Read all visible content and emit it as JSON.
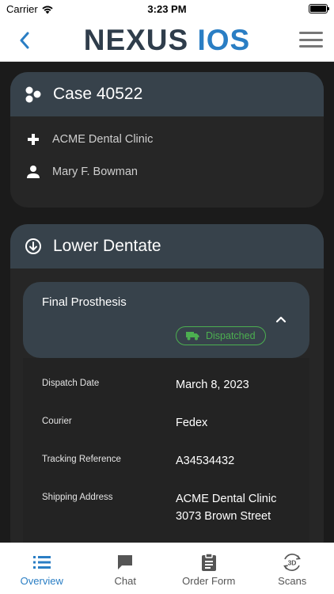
{
  "status_bar": {
    "carrier": "Carrier",
    "time": "3:23 PM"
  },
  "nav": {
    "logo_primary": "NEXUS",
    "logo_secondary": "IOS"
  },
  "case_card": {
    "title": "Case 40522",
    "clinic": "ACME Dental Clinic",
    "patient": "Mary F. Bowman"
  },
  "dentate_card": {
    "title": "Lower Dentate",
    "prosthesis": {
      "title": "Final Prosthesis",
      "status": "Dispatched"
    },
    "details": [
      {
        "label": "Dispatch Date",
        "value": "March 8, 2023"
      },
      {
        "label": "Courier",
        "value": "Fedex"
      },
      {
        "label": "Tracking Reference",
        "value": "A34534432"
      },
      {
        "label": "Shipping Address",
        "value": "ACME Dental Clinic",
        "value2": "3073 Brown Street"
      }
    ]
  },
  "tabs": [
    {
      "label": "Overview",
      "icon": "list-icon",
      "active": true
    },
    {
      "label": "Chat",
      "icon": "chat-icon",
      "active": false
    },
    {
      "label": "Order Form",
      "icon": "clipboard-icon",
      "active": false
    },
    {
      "label": "Scans",
      "icon": "3d-scan-icon",
      "badge": "3D",
      "active": false
    }
  ],
  "colors": {
    "accent": "#2a7ec4",
    "logo_dark": "#2f3d4b",
    "card_header": "#37424b",
    "status_green": "#4caf50",
    "background": "#1b1b1b"
  }
}
